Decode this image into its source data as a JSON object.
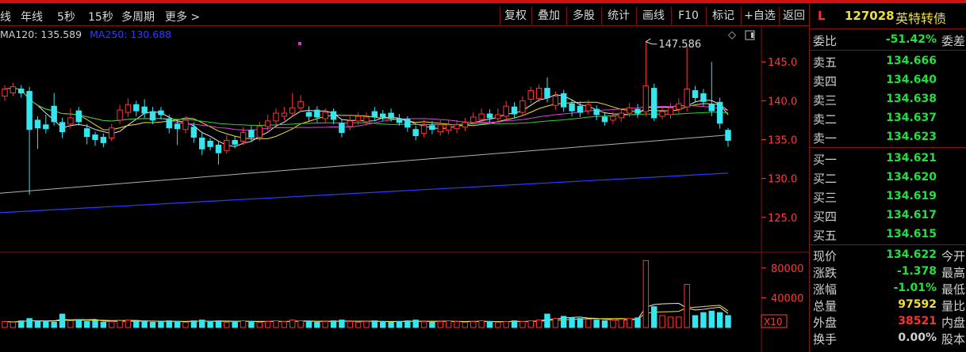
{
  "toolbar": {
    "left_items": [
      "线",
      "年线",
      "5秒",
      "15秒",
      "多周期",
      "更多 >"
    ],
    "right_items": [
      "复权",
      "叠加",
      "多股",
      "统计",
      "画线",
      "F10",
      "标记",
      "+自选",
      "返回"
    ]
  },
  "legend": {
    "ma120": "MA120: 135.589",
    "ma250": "MA250: 130.688"
  },
  "chart": {
    "high_label": "147.586",
    "volume_scale_label": "X10"
  },
  "quote": {
    "market": "L",
    "code": "127028",
    "name": "英特转债",
    "weibi": {
      "label": "委比",
      "value": "-51.42%",
      "right_label": "委差"
    },
    "asks": [
      {
        "label": "卖五",
        "price": "134.666"
      },
      {
        "label": "卖四",
        "price": "134.640"
      },
      {
        "label": "卖三",
        "price": "134.638"
      },
      {
        "label": "卖二",
        "price": "134.637"
      },
      {
        "label": "卖一",
        "price": "134.623"
      }
    ],
    "bids": [
      {
        "label": "买一",
        "price": "134.621"
      },
      {
        "label": "买二",
        "price": "134.620"
      },
      {
        "label": "买三",
        "price": "134.619"
      },
      {
        "label": "买四",
        "price": "134.617"
      },
      {
        "label": "买五",
        "price": "134.615"
      }
    ],
    "stats": [
      {
        "label": "现价",
        "value": "134.622",
        "right_label": "今开",
        "color": "#22e040"
      },
      {
        "label": "涨跌",
        "value": "-1.378",
        "right_label": "最高",
        "color": "#22e040"
      },
      {
        "label": "涨幅",
        "value": "-1.01%",
        "right_label": "最低",
        "color": "#22e040"
      },
      {
        "label": "总量",
        "value": "97592",
        "right_label": "量比",
        "color": "#f0e030"
      },
      {
        "label": "外盘",
        "value": "38521",
        "right_label": "内盘",
        "color": "#ff3030"
      },
      {
        "label": "换手",
        "value": "0.00%",
        "right_label": "股本",
        "color": "#d0d0d0"
      }
    ]
  },
  "colors": {
    "up": "#ff3333",
    "down": "#33e6f0",
    "grid": "#8a1010",
    "axis_text": "#ff3a3a",
    "ma5": "#e8e8e8",
    "ma10": "#f0e030",
    "ma20": "#e040e0",
    "ma60": "#30d030",
    "ma120": "#b0b0b0",
    "ma250": "#2a3cff"
  },
  "chart_data": {
    "type": "candlestick",
    "price_axis": {
      "ticks": [
        125.0,
        130.0,
        135.0,
        140.0,
        145.0
      ],
      "tick_labels": [
        "125.0",
        "130.0",
        "135.0",
        "140.0",
        "145.0"
      ],
      "ylim": [
        120.6,
        149.7
      ]
    },
    "volume_axis": {
      "ticks": [
        40000,
        80000
      ],
      "tick_labels": [
        "40000",
        "80000"
      ],
      "ylim": [
        0,
        100000
      ]
    },
    "annotations": [
      {
        "text": "147.586",
        "value": 147.586
      }
    ],
    "candles": [
      {
        "o": 140.6,
        "c": 141.5,
        "h": 142.0,
        "l": 140.0,
        "v": 8000
      },
      {
        "o": 141.0,
        "c": 141.8,
        "h": 142.3,
        "l": 140.6,
        "v": 7000
      },
      {
        "o": 141.5,
        "c": 141.0,
        "h": 142.0,
        "l": 140.4,
        "v": 9000
      },
      {
        "o": 141.2,
        "c": 136.3,
        "h": 141.8,
        "l": 127.9,
        "v": 12000
      },
      {
        "o": 137.5,
        "c": 136.5,
        "h": 138.0,
        "l": 133.8,
        "v": 8000
      },
      {
        "o": 136.9,
        "c": 136.4,
        "h": 138.2,
        "l": 135.8,
        "v": 9000
      },
      {
        "o": 139.3,
        "c": 137.3,
        "h": 141.0,
        "l": 136.8,
        "v": 7000
      },
      {
        "o": 137.2,
        "c": 136.0,
        "h": 137.8,
        "l": 135.2,
        "v": 18000
      },
      {
        "o": 137.0,
        "c": 137.8,
        "h": 139.0,
        "l": 136.4,
        "v": 9000
      },
      {
        "o": 138.7,
        "c": 137.3,
        "h": 139.2,
        "l": 136.8,
        "v": 10000
      },
      {
        "o": 136.4,
        "c": 135.4,
        "h": 137.0,
        "l": 134.4,
        "v": 8000
      },
      {
        "o": 135.6,
        "c": 135.0,
        "h": 136.0,
        "l": 134.2,
        "v": 9000
      },
      {
        "o": 135.3,
        "c": 134.6,
        "h": 135.8,
        "l": 134.0,
        "v": 7000
      },
      {
        "o": 135.2,
        "c": 136.5,
        "h": 137.0,
        "l": 134.8,
        "v": 8000
      },
      {
        "o": 137.5,
        "c": 138.8,
        "h": 139.5,
        "l": 137.0,
        "v": 9000
      },
      {
        "o": 138.5,
        "c": 139.5,
        "h": 140.3,
        "l": 137.9,
        "v": 10000
      },
      {
        "o": 139.5,
        "c": 138.7,
        "h": 140.0,
        "l": 138.0,
        "v": 8000
      },
      {
        "o": 139.2,
        "c": 138.4,
        "h": 140.2,
        "l": 137.8,
        "v": 9000
      },
      {
        "o": 138.6,
        "c": 137.5,
        "h": 139.2,
        "l": 137.0,
        "v": 7000
      },
      {
        "o": 138.7,
        "c": 138.2,
        "h": 139.2,
        "l": 137.6,
        "v": 8000
      },
      {
        "o": 137.6,
        "c": 136.5,
        "h": 138.2,
        "l": 135.8,
        "v": 9000
      },
      {
        "o": 137.0,
        "c": 136.4,
        "h": 137.6,
        "l": 134.3,
        "v": 8000
      },
      {
        "o": 136.3,
        "c": 137.5,
        "h": 138.0,
        "l": 135.8,
        "v": 7000
      },
      {
        "o": 136.6,
        "c": 135.3,
        "h": 137.2,
        "l": 134.6,
        "v": 9000
      },
      {
        "o": 135.2,
        "c": 133.8,
        "h": 136.0,
        "l": 133.0,
        "v": 10000
      },
      {
        "o": 134.8,
        "c": 134.1,
        "h": 135.2,
        "l": 133.6,
        "v": 8000
      },
      {
        "o": 134.3,
        "c": 133.3,
        "h": 134.8,
        "l": 131.8,
        "v": 9000
      },
      {
        "o": 133.6,
        "c": 134.9,
        "h": 135.6,
        "l": 133.2,
        "v": 7000
      },
      {
        "o": 134.9,
        "c": 134.4,
        "h": 135.4,
        "l": 133.9,
        "v": 8000
      },
      {
        "o": 134.8,
        "c": 135.9,
        "h": 136.6,
        "l": 134.3,
        "v": 9000
      },
      {
        "o": 136.2,
        "c": 135.3,
        "h": 136.8,
        "l": 134.8,
        "v": 8000
      },
      {
        "o": 135.3,
        "c": 136.7,
        "h": 137.3,
        "l": 134.8,
        "v": 7000
      },
      {
        "o": 136.7,
        "c": 137.4,
        "h": 138.2,
        "l": 136.1,
        "v": 8000
      },
      {
        "o": 137.4,
        "c": 138.4,
        "h": 139.0,
        "l": 136.8,
        "v": 9000
      },
      {
        "o": 138.0,
        "c": 138.4,
        "h": 139.2,
        "l": 137.5,
        "v": 8000
      },
      {
        "o": 138.4,
        "c": 139.1,
        "h": 141.0,
        "l": 137.9,
        "v": 10000
      },
      {
        "o": 139.1,
        "c": 139.9,
        "h": 140.7,
        "l": 138.6,
        "v": 9000
      },
      {
        "o": 138.5,
        "c": 138.0,
        "h": 139.3,
        "l": 137.4,
        "v": 8000
      },
      {
        "o": 138.8,
        "c": 137.9,
        "h": 139.3,
        "l": 137.2,
        "v": 7000
      },
      {
        "o": 137.7,
        "c": 138.5,
        "h": 139.0,
        "l": 137.2,
        "v": 8000
      },
      {
        "o": 138.6,
        "c": 137.6,
        "h": 139.0,
        "l": 137.0,
        "v": 9000
      },
      {
        "o": 137.1,
        "c": 135.9,
        "h": 137.6,
        "l": 135.3,
        "v": 10000
      },
      {
        "o": 136.7,
        "c": 137.4,
        "h": 138.0,
        "l": 136.2,
        "v": 8000
      },
      {
        "o": 137.4,
        "c": 138.0,
        "h": 138.5,
        "l": 136.9,
        "v": 7000
      },
      {
        "o": 137.3,
        "c": 137.9,
        "h": 138.5,
        "l": 136.8,
        "v": 8000
      },
      {
        "o": 138.6,
        "c": 137.9,
        "h": 139.2,
        "l": 137.4,
        "v": 9000
      },
      {
        "o": 138.3,
        "c": 137.9,
        "h": 138.8,
        "l": 137.4,
        "v": 8000
      },
      {
        "o": 138.4,
        "c": 137.8,
        "h": 139.0,
        "l": 137.3,
        "v": 7000
      },
      {
        "o": 137.7,
        "c": 137.2,
        "h": 138.3,
        "l": 136.8,
        "v": 8000
      },
      {
        "o": 137.6,
        "c": 136.6,
        "h": 138.0,
        "l": 136.0,
        "v": 9000
      },
      {
        "o": 136.3,
        "c": 135.5,
        "h": 136.8,
        "l": 134.9,
        "v": 10000
      },
      {
        "o": 135.8,
        "c": 136.8,
        "h": 137.5,
        "l": 135.3,
        "v": 8000
      },
      {
        "o": 136.8,
        "c": 136.3,
        "h": 137.4,
        "l": 135.7,
        "v": 7000
      },
      {
        "o": 136.0,
        "c": 136.9,
        "h": 137.5,
        "l": 135.5,
        "v": 8000
      },
      {
        "o": 136.2,
        "c": 136.9,
        "h": 137.5,
        "l": 135.7,
        "v": 9000
      },
      {
        "o": 136.4,
        "c": 136.9,
        "h": 137.5,
        "l": 135.8,
        "v": 8000
      },
      {
        "o": 136.6,
        "c": 137.2,
        "h": 137.8,
        "l": 136.1,
        "v": 7000
      },
      {
        "o": 137.2,
        "c": 137.9,
        "h": 138.5,
        "l": 136.7,
        "v": 8000
      },
      {
        "o": 137.6,
        "c": 138.3,
        "h": 139.0,
        "l": 137.1,
        "v": 9000
      },
      {
        "o": 138.3,
        "c": 137.8,
        "h": 138.9,
        "l": 137.2,
        "v": 8000
      },
      {
        "o": 137.7,
        "c": 138.2,
        "h": 139.0,
        "l": 137.2,
        "v": 7000
      },
      {
        "o": 138.0,
        "c": 139.3,
        "h": 140.0,
        "l": 137.5,
        "v": 8000
      },
      {
        "o": 139.2,
        "c": 138.3,
        "h": 139.8,
        "l": 137.8,
        "v": 9000
      },
      {
        "o": 138.5,
        "c": 140.0,
        "h": 140.6,
        "l": 138.0,
        "v": 8000
      },
      {
        "o": 140.2,
        "c": 141.3,
        "h": 141.8,
        "l": 139.7,
        "v": 9000
      },
      {
        "o": 140.3,
        "c": 141.6,
        "h": 142.1,
        "l": 139.8,
        "v": 10000
      },
      {
        "o": 141.6,
        "c": 140.4,
        "h": 143.0,
        "l": 139.8,
        "v": 18000
      },
      {
        "o": 139.4,
        "c": 140.6,
        "h": 141.2,
        "l": 138.8,
        "v": 12000
      },
      {
        "o": 140.9,
        "c": 139.2,
        "h": 141.4,
        "l": 138.6,
        "v": 15000
      },
      {
        "o": 139.6,
        "c": 138.7,
        "h": 140.2,
        "l": 138.0,
        "v": 13000
      },
      {
        "o": 139.3,
        "c": 138.5,
        "h": 139.9,
        "l": 137.9,
        "v": 12000
      },
      {
        "o": 138.7,
        "c": 139.5,
        "h": 140.1,
        "l": 138.2,
        "v": 11000
      },
      {
        "o": 138.9,
        "c": 138.2,
        "h": 139.4,
        "l": 137.5,
        "v": 10000
      },
      {
        "o": 137.9,
        "c": 137.3,
        "h": 138.4,
        "l": 136.8,
        "v": 9000
      },
      {
        "o": 137.5,
        "c": 138.0,
        "h": 138.6,
        "l": 137.0,
        "v": 10000
      },
      {
        "o": 137.8,
        "c": 138.4,
        "h": 139.0,
        "l": 137.3,
        "v": 11000
      },
      {
        "o": 138.4,
        "c": 139.1,
        "h": 139.7,
        "l": 137.9,
        "v": 12000
      },
      {
        "o": 138.9,
        "c": 138.4,
        "h": 139.6,
        "l": 137.8,
        "v": 13000
      },
      {
        "o": 138.6,
        "c": 141.9,
        "h": 147.586,
        "l": 138.0,
        "v": 90000
      },
      {
        "o": 141.6,
        "c": 137.8,
        "h": 142.2,
        "l": 137.4,
        "v": 28000
      },
      {
        "o": 138.0,
        "c": 138.6,
        "h": 139.2,
        "l": 137.6,
        "v": 16000
      },
      {
        "o": 138.2,
        "c": 139.1,
        "h": 139.7,
        "l": 137.7,
        "v": 14000
      },
      {
        "o": 138.9,
        "c": 139.6,
        "h": 140.3,
        "l": 138.3,
        "v": 14000
      },
      {
        "o": 139.2,
        "c": 141.5,
        "h": 147.0,
        "l": 138.6,
        "v": 58000
      },
      {
        "o": 141.3,
        "c": 140.4,
        "h": 141.9,
        "l": 139.8,
        "v": 16000
      },
      {
        "o": 140.9,
        "c": 139.9,
        "h": 141.5,
        "l": 139.3,
        "v": 20000
      },
      {
        "o": 139.5,
        "c": 138.7,
        "h": 145.0,
        "l": 138.0,
        "v": 22000
      },
      {
        "o": 139.8,
        "c": 137.1,
        "h": 140.4,
        "l": 136.4,
        "v": 20000
      },
      {
        "o": 136.2,
        "c": 134.9,
        "h": 136.5,
        "l": 134.1,
        "v": 16000
      }
    ]
  }
}
